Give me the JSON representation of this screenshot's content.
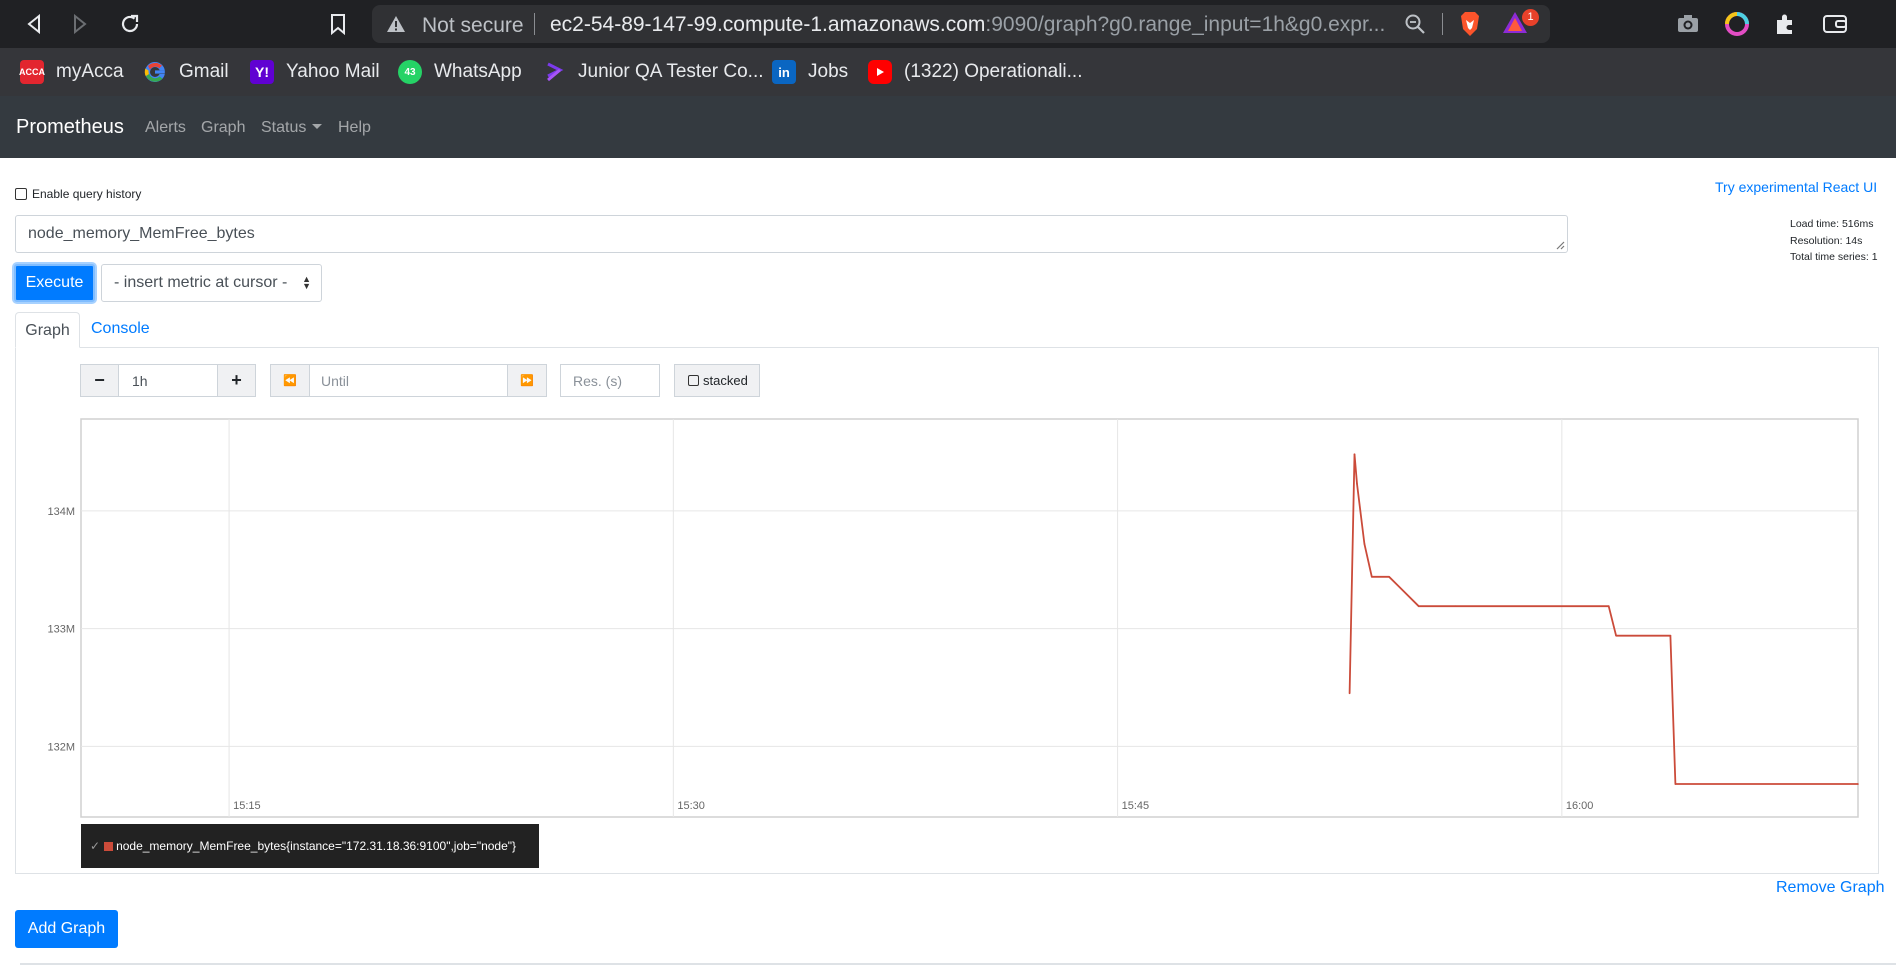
{
  "browser": {
    "security_label": "Not secure",
    "url_host": "ec2-54-89-147-99.compute-1.amazonaws.com",
    "url_rest": ":9090/graph?g0.range_input=1h&g0.expr...",
    "rewards_badge": "1",
    "bookmarks": [
      {
        "label": "myAcca",
        "icon": "acca-icon",
        "color": "#e3262f"
      },
      {
        "label": "Gmail",
        "icon": "google-icon",
        "color": "#ffffff"
      },
      {
        "label": "Yahoo Mail",
        "icon": "yahoo-icon",
        "color": "#6001d2"
      },
      {
        "label": "WhatsApp",
        "icon": "whatsapp-icon",
        "color": "#25d366"
      },
      {
        "label": "Junior QA Tester Co...",
        "icon": "slack-icon",
        "color": "#4a154b"
      },
      {
        "label": "Jobs",
        "icon": "linkedin-icon",
        "color": "#0a66c2"
      },
      {
        "label": "(1322) Operationali...",
        "icon": "youtube-icon",
        "color": "#ff0000"
      }
    ],
    "whatsapp_badge": "43"
  },
  "navbar": {
    "brand": "Prometheus",
    "links": [
      "Alerts",
      "Graph",
      "Status",
      "Help"
    ]
  },
  "query": {
    "history_label": "Enable query history",
    "react_ui_link": "Try experimental React UI",
    "expression": "node_memory_MemFree_bytes",
    "stats": {
      "load_time": "Load time: 516ms",
      "resolution": "Resolution: 14s",
      "total_series": "Total time series: 1"
    },
    "execute_label": "Execute",
    "metric_select": "- insert metric at cursor -"
  },
  "tabs": {
    "graph": "Graph",
    "console": "Console"
  },
  "controls": {
    "minus": "−",
    "range": "1h",
    "plus": "+",
    "back": "⏪",
    "until_placeholder": "Until",
    "forward": "⏩",
    "res_placeholder": "Res. (s)",
    "stacked": "stacked"
  },
  "chart_data": {
    "type": "line",
    "x_ticks": [
      "15:15",
      "15:30",
      "15:45",
      "16:00"
    ],
    "y_ticks": [
      "134M",
      "133M",
      "132M"
    ],
    "xlim": [
      "15:10",
      "16:10"
    ],
    "ylim": [
      131.4,
      134.78
    ],
    "grid": true,
    "legend_placement": "bottom-left",
    "series": [
      {
        "name": "node_memory_MemFree_bytes{instance=\"172.31.18.36:9100\",job=\"node\"}",
        "color": "#cb4b3a",
        "x": [
          "15:52:50",
          "15:53:00",
          "15:53:05",
          "15:53:20",
          "15:53:35",
          "15:54:10",
          "15:55:10",
          "15:56:25",
          "16:01:35",
          "16:01:50",
          "16:03:40",
          "16:03:50",
          "16:10:00"
        ],
        "y": [
          132.45,
          134.48,
          134.23,
          133.72,
          133.44,
          133.44,
          133.19,
          133.19,
          133.19,
          132.94,
          132.94,
          131.68,
          131.68
        ]
      }
    ]
  },
  "actions": {
    "remove": "Remove Graph",
    "add": "Add Graph"
  }
}
